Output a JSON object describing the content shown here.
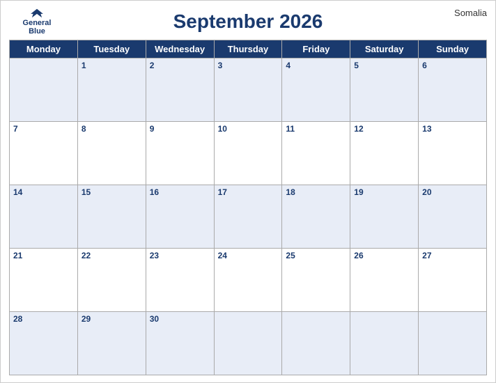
{
  "header": {
    "title": "September 2026",
    "country": "Somalia",
    "logo_general": "General",
    "logo_blue": "Blue"
  },
  "days_of_week": [
    "Monday",
    "Tuesday",
    "Wednesday",
    "Thursday",
    "Friday",
    "Saturday",
    "Sunday"
  ],
  "weeks": [
    [
      null,
      1,
      2,
      3,
      4,
      5,
      6
    ],
    [
      7,
      8,
      9,
      10,
      11,
      12,
      13
    ],
    [
      14,
      15,
      16,
      17,
      18,
      19,
      20
    ],
    [
      21,
      22,
      23,
      24,
      25,
      26,
      27
    ],
    [
      28,
      29,
      30,
      null,
      null,
      null,
      null
    ]
  ]
}
